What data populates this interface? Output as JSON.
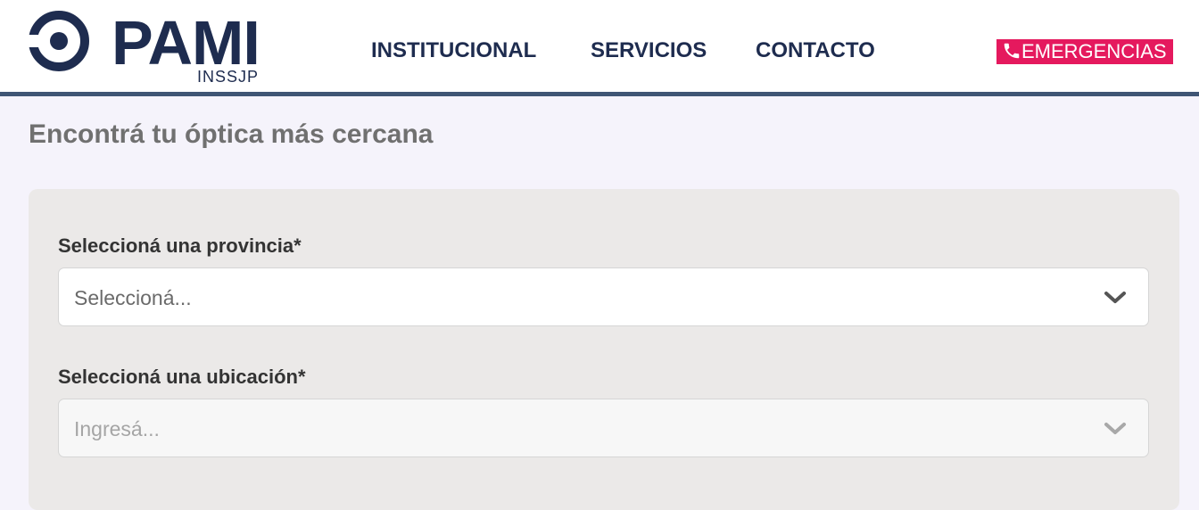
{
  "brand": {
    "name": "PAMI",
    "sub": "INSSJP"
  },
  "nav": {
    "items": [
      {
        "label": "INSTITUCIONAL"
      },
      {
        "label": "SERVICIOS"
      },
      {
        "label": "CONTACTO"
      }
    ],
    "emergency_label": "EMERGENCIAS"
  },
  "page": {
    "title": "Encontrá tu óptica más cercana"
  },
  "form": {
    "province": {
      "label": "Seleccioná una provincia*",
      "placeholder": "Seleccioná..."
    },
    "location": {
      "label": "Seleccioná una ubicación*",
      "placeholder": "Ingresá..."
    }
  },
  "colors": {
    "brand_navy": "#1e2c4f",
    "emergency": "#e5195e",
    "header_border": "#3f5574",
    "panel": "#ebe9e8"
  },
  "icons": {
    "emergency": "phone-icon",
    "select": "chevron-down-icon",
    "logo": "pami-logo-icon"
  }
}
